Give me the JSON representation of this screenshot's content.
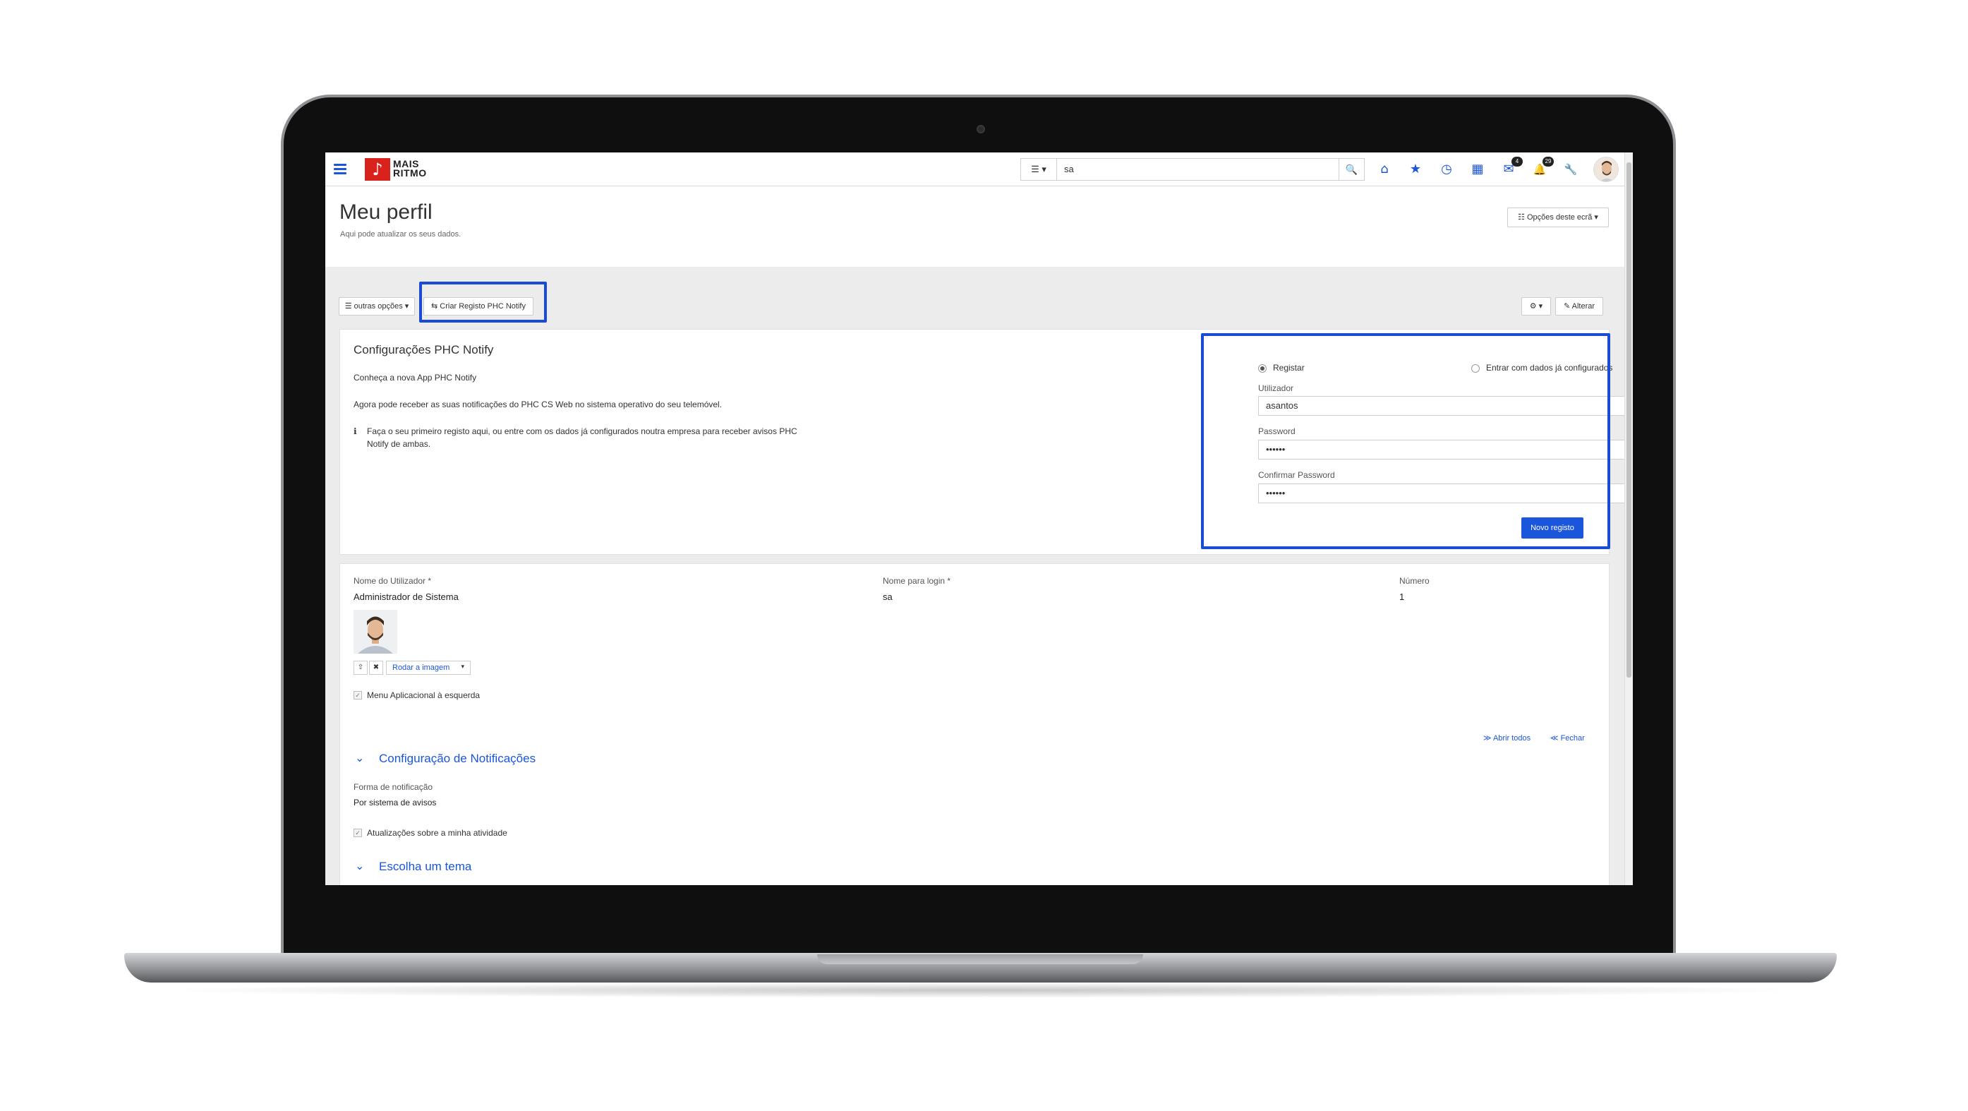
{
  "app": {
    "logo_line1": "MAIS",
    "logo_line2": "RITMO",
    "logo_glyph": "♪",
    "accent_color": "#1a56db",
    "brand_color": "#d9221b"
  },
  "search": {
    "type_label": "☰ ▾",
    "value": "sa",
    "button_icon": "🔍"
  },
  "nav_icons": [
    {
      "name": "home-icon",
      "glyph": "⌂"
    },
    {
      "name": "star-icon",
      "glyph": "★"
    },
    {
      "name": "clock-icon",
      "glyph": "◷"
    },
    {
      "name": "calendar-icon",
      "glyph": "▦"
    },
    {
      "name": "mail-icon",
      "glyph": "✉",
      "badge": "4"
    },
    {
      "name": "bell-icon",
      "glyph": "🔔",
      "badge": "29"
    },
    {
      "name": "wrench-icon",
      "glyph": "🔧"
    }
  ],
  "header": {
    "title": "Meu perfil",
    "subtitle": "Aqui pode atualizar os seus dados.",
    "screen_options": "☷ Opções deste ecrã ▾"
  },
  "toolbar": {
    "other_options": "☰ outras opções ▾",
    "create_notify": "⇆ Criar Registo PHC Notify",
    "settings_menu": "⚙ ▾",
    "edit": "✎ Alterar"
  },
  "notify_panel": {
    "title": "Configurações PHC Notify",
    "intro": "Conheça a nova App PHC Notify",
    "description": "Agora pode receber as suas notificações do PHC CS Web no sistema operativo do seu telemóvel.",
    "info_icon": "ℹ",
    "info_line1": "Faça o seu primeiro registo aqui, ou entre com os dados já configurados noutra empresa para receber avisos PHC",
    "info_line2": "Notify de ambas.",
    "radio_register": "Registar",
    "radio_existing": "Entrar com dados já configurados",
    "user_label": "Utilizador",
    "user_value": "asantos",
    "password_label": "Password",
    "password_value": "••••••",
    "confirm_label": "Confirmar Password",
    "confirm_value": "••••••",
    "submit": "Novo registo"
  },
  "profile": {
    "name_label": "Nome do Utilizador *",
    "name_value": "Administrador de Sistema",
    "login_label": "Nome para login *",
    "login_value": "sa",
    "number_label": "Número",
    "number_value": "1",
    "upload_icon": "⇧",
    "delete_icon": "✖",
    "rotate_label": "Rodar a imagem",
    "rotate_caret": "▾",
    "menu_left_label": "Menu Aplicacional à esquerda",
    "open_all": "≫ Abrir todos",
    "close_all": "≪ Fechar"
  },
  "notifications_section": {
    "title": "Configuração de Notificações",
    "form_label": "Forma de notificação",
    "form_value": "Por sistema de avisos",
    "activity_label": "Atualizações sobre a minha atividade"
  },
  "theme_section": {
    "title": "Escolha um tema"
  }
}
